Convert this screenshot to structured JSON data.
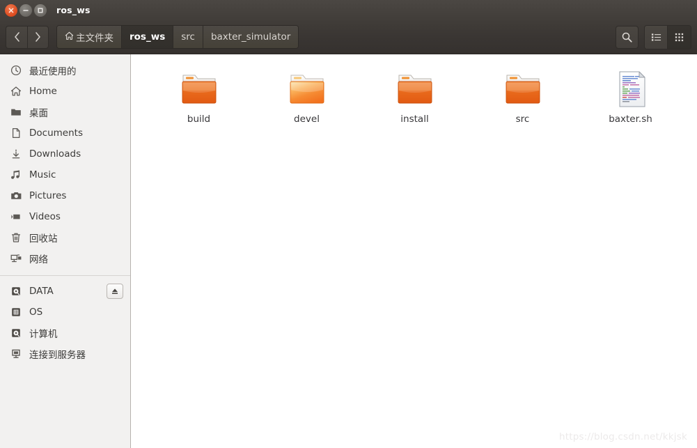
{
  "window": {
    "title": "ros_ws",
    "controls": {
      "close": "close",
      "minimize": "minimize",
      "maximize": "maximize"
    }
  },
  "toolbar": {
    "back_label": "‹",
    "forward_label": "›",
    "breadcrumb": [
      {
        "label": "主文件夹",
        "icon": "home-icon",
        "active": false
      },
      {
        "label": "ros_ws",
        "icon": "",
        "active": true
      },
      {
        "label": "src",
        "icon": "",
        "active": false
      },
      {
        "label": "baxter_simulator",
        "icon": "",
        "active": false
      }
    ],
    "search_icon": "search-icon",
    "view_list_icon": "list-view-icon",
    "view_grid_icon": "grid-view-icon",
    "active_view": "grid"
  },
  "sidebar": {
    "groups": [
      {
        "items": [
          {
            "label": "最近使用的",
            "icon": "clock-icon",
            "eject": false
          },
          {
            "label": "Home",
            "icon": "home-icon",
            "eject": false
          },
          {
            "label": "桌面",
            "icon": "folder-icon",
            "eject": false
          },
          {
            "label": "Documents",
            "icon": "document-icon",
            "eject": false
          },
          {
            "label": "Downloads",
            "icon": "download-icon",
            "eject": false
          },
          {
            "label": "Music",
            "icon": "music-icon",
            "eject": false
          },
          {
            "label": "Pictures",
            "icon": "camera-icon",
            "eject": false
          },
          {
            "label": "Videos",
            "icon": "video-icon",
            "eject": false
          },
          {
            "label": "回收站",
            "icon": "trash-icon",
            "eject": false
          },
          {
            "label": "网络",
            "icon": "network-icon",
            "eject": false
          }
        ]
      },
      {
        "items": [
          {
            "label": "DATA",
            "icon": "drive-icon",
            "eject": true
          },
          {
            "label": "OS",
            "icon": "disk-icon",
            "eject": false
          },
          {
            "label": "计算机",
            "icon": "drive-icon",
            "eject": false
          },
          {
            "label": "连接到服务器",
            "icon": "server-icon",
            "eject": false
          }
        ]
      }
    ]
  },
  "files": [
    {
      "name": "build",
      "type": "folder",
      "variant": "normal"
    },
    {
      "name": "devel",
      "type": "folder",
      "variant": "light"
    },
    {
      "name": "install",
      "type": "folder",
      "variant": "normal"
    },
    {
      "name": "src",
      "type": "folder",
      "variant": "normal"
    },
    {
      "name": "baxter.sh",
      "type": "script",
      "variant": "normal"
    }
  ],
  "watermark": "https://blog.csdn.net/kkjsk",
  "colors": {
    "titlebar": "#413d39",
    "toolbar": "#3a3633",
    "sidebar_bg": "#f2f1f0",
    "content_bg": "#ffffff",
    "folder_orange": "#e8621a",
    "close_button": "#df4f23",
    "text_light": "#d9d5d1",
    "text_dark": "#3c3b39"
  }
}
